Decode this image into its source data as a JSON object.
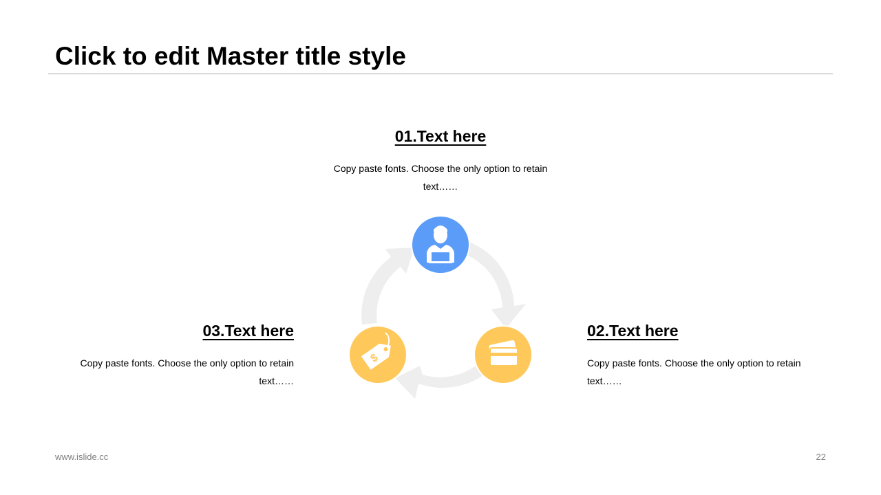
{
  "slide": {
    "title": "Click to edit Master title style",
    "footer_url": "www.islide.cc",
    "page_number": "22"
  },
  "items": [
    {
      "heading": "01.Text here",
      "body": "Copy paste fonts. Choose the only option to retain text……",
      "icon": "person-laptop-icon",
      "color": "#5b9cf8"
    },
    {
      "heading": "02.Text here",
      "body": "Copy paste fonts. Choose the only option to retain text……",
      "icon": "credit-card-icon",
      "color": "#ffc85a"
    },
    {
      "heading": "03.Text here",
      "body": "Copy paste fonts. Choose the only option to retain text……",
      "icon": "price-tag-icon",
      "color": "#ffc85a"
    }
  ],
  "colors": {
    "arrow": "#eeeeee",
    "rule": "#a6a6a6"
  }
}
